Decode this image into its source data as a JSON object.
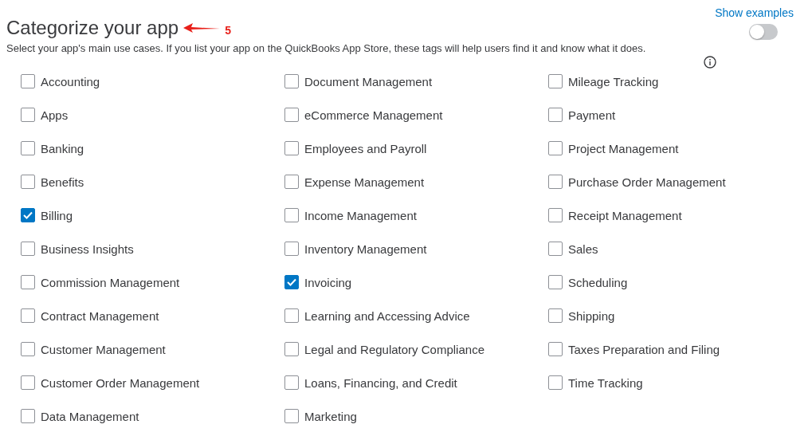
{
  "header": {
    "title": "Categorize your app",
    "annotation": {
      "label": "5"
    },
    "show_examples": {
      "label": "Show examples",
      "on": false
    },
    "description": "Select your app's main use cases. If you list your app on the QuickBooks App Store, these tags will help users find it and know what it does."
  },
  "columns": [
    [
      {
        "label": "Accounting",
        "checked": false
      },
      {
        "label": "Apps",
        "checked": false
      },
      {
        "label": "Banking",
        "checked": false
      },
      {
        "label": "Benefits",
        "checked": false
      },
      {
        "label": "Billing",
        "checked": true
      },
      {
        "label": "Business Insights",
        "checked": false
      },
      {
        "label": "Commission Management",
        "checked": false
      },
      {
        "label": "Contract Management",
        "checked": false
      },
      {
        "label": "Customer Management",
        "checked": false
      },
      {
        "label": "Customer Order Management",
        "checked": false
      },
      {
        "label": "Data Management",
        "checked": false
      }
    ],
    [
      {
        "label": "Document Management",
        "checked": false
      },
      {
        "label": "eCommerce Management",
        "checked": false
      },
      {
        "label": "Employees and Payroll",
        "checked": false
      },
      {
        "label": "Expense Management",
        "checked": false
      },
      {
        "label": "Income Management",
        "checked": false
      },
      {
        "label": "Inventory Management",
        "checked": false
      },
      {
        "label": "Invoicing",
        "checked": true
      },
      {
        "label": "Learning and Accessing Advice",
        "checked": false
      },
      {
        "label": "Legal and Regulatory Compliance",
        "checked": false
      },
      {
        "label": "Loans, Financing, and Credit",
        "checked": false
      },
      {
        "label": "Marketing",
        "checked": false
      }
    ],
    [
      {
        "label": "Mileage Tracking",
        "checked": false
      },
      {
        "label": "Payment",
        "checked": false
      },
      {
        "label": "Project Management",
        "checked": false
      },
      {
        "label": "Purchase Order Management",
        "checked": false
      },
      {
        "label": "Receipt Management",
        "checked": false
      },
      {
        "label": "Sales",
        "checked": false
      },
      {
        "label": "Scheduling",
        "checked": false
      },
      {
        "label": "Shipping",
        "checked": false
      },
      {
        "label": "Taxes Preparation and Filing",
        "checked": false
      },
      {
        "label": "Time Tracking",
        "checked": false
      }
    ]
  ]
}
